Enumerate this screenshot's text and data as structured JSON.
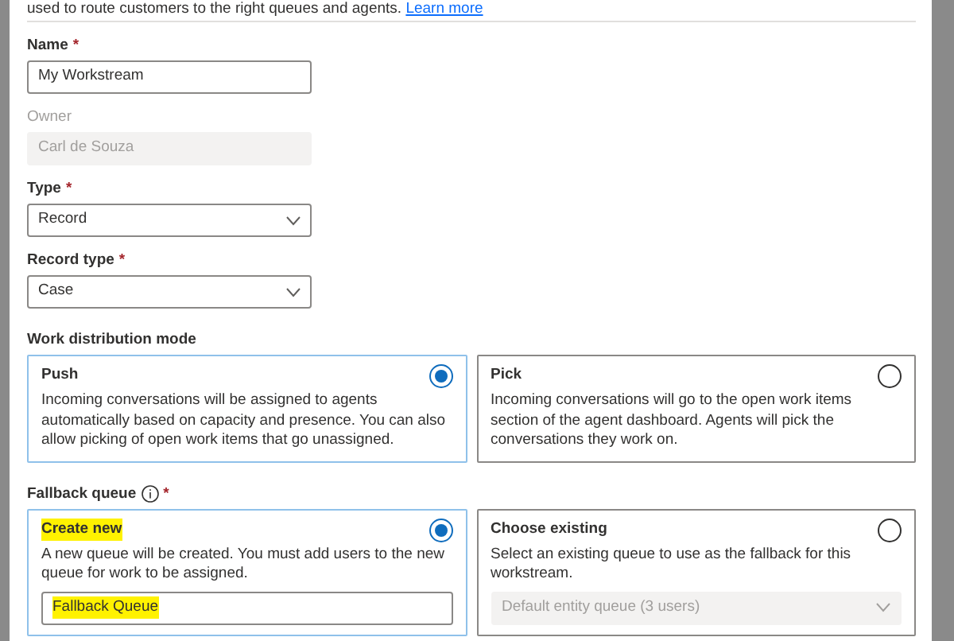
{
  "intro": {
    "text": "used to route customers to the right queues and agents.",
    "link": "Learn more"
  },
  "fields": [
    {
      "kind": "text",
      "label": "Name",
      "required_mark": "*",
      "value": "My Workstream",
      "disabled": false
    },
    {
      "kind": "text",
      "label": "Owner",
      "value": "Carl de Souza",
      "disabled": true
    },
    {
      "kind": "select",
      "label": "Type",
      "required_mark": "*",
      "value": "Record",
      "disabled": false
    },
    {
      "kind": "select",
      "label": "Record type",
      "required_mark": "*",
      "value": "Case",
      "disabled": false
    }
  ],
  "work_distribution": {
    "label": "Work distribution mode",
    "options": [
      {
        "title": "Push",
        "title_highlighted": false,
        "description": "Incoming conversations will be assigned to agents automatically based on capacity and presence. You can also allow picking of open work items that go unassigned.",
        "selected": true
      },
      {
        "title": "Pick",
        "title_highlighted": false,
        "description": "Incoming conversations will go to the open work items section of the agent dashboard. Agents will pick the conversations they work on.",
        "selected": false
      }
    ]
  },
  "fallback_queue": {
    "label": "Fallback queue",
    "required_mark": "*",
    "info": true,
    "options": [
      {
        "title": "Create new",
        "title_highlighted": true,
        "description": "A new queue will be created. You must add users to the new queue for work to be assigned.",
        "selected": true,
        "input": {
          "kind": "text",
          "value": "Fallback Queue",
          "highlighted": true,
          "disabled": false
        }
      },
      {
        "title": "Choose existing",
        "title_highlighted": false,
        "description": "Select an existing queue to use as the fallback for this workstream.",
        "selected": false,
        "input": {
          "kind": "select",
          "value": "Default entity queue (3 users)",
          "disabled": true
        }
      }
    ]
  }
}
